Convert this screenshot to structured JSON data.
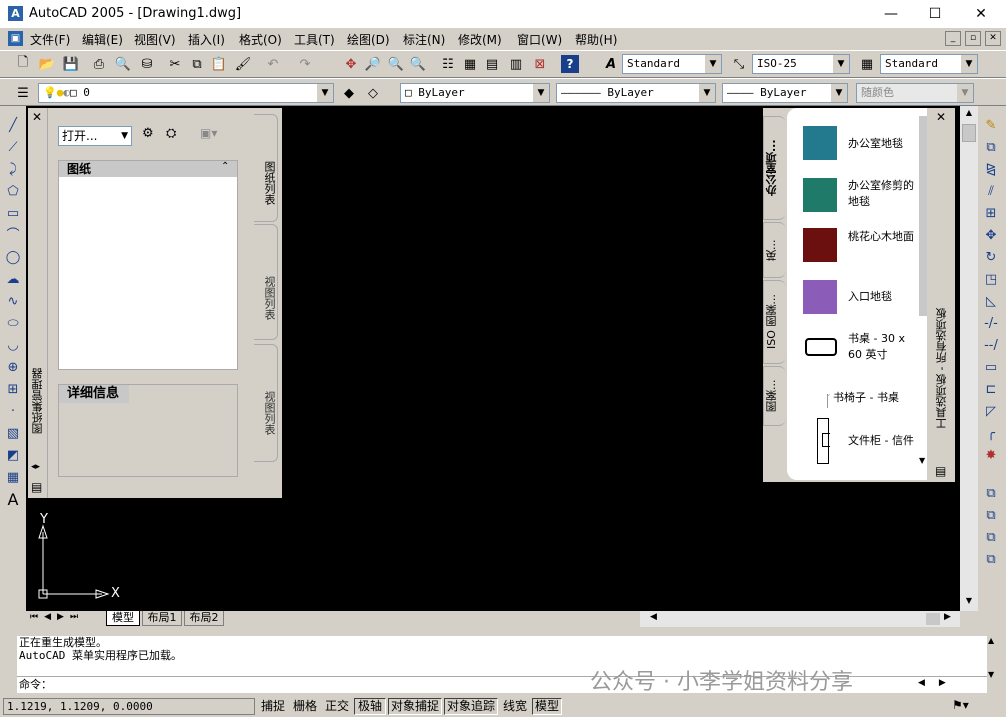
{
  "window": {
    "title": "AutoCAD 2005 - [Drawing1.dwg]",
    "app_icon": "A",
    "min": "—",
    "max": "☐",
    "close": "✕"
  },
  "menu": [
    "文件(F)",
    "编辑(E)",
    "视图(V)",
    "插入(I)",
    "格式(O)",
    "工具(T)",
    "绘图(D)",
    "标注(N)",
    "修改(M)",
    "窗口(W)",
    "帮助(H)"
  ],
  "toolbar": {
    "text_style": "Standard",
    "dim_style": "ISO-25",
    "table_style": "Standard",
    "layer": "0",
    "color": "ByLayer",
    "linetype": "ByLayer",
    "lineweight": "ByLayer",
    "plotstyle": "随颜色"
  },
  "sheet_manager": {
    "title": "图纸集管理器",
    "open_label": "打开...",
    "list_header": "图纸",
    "detail_header": "详细信息",
    "tabs": [
      "图纸列表",
      "视图列表",
      "视图列表"
    ]
  },
  "tool_palette": {
    "title": "工具选项板 - 所有选项板",
    "tabs": [
      "办公室项...",
      "英...",
      "ISO 图案...",
      "图案..."
    ],
    "items": [
      {
        "label": "办公室地毯",
        "color": "#23798e"
      },
      {
        "label": "办公室修剪的地毯",
        "color": "#1f7a6a"
      },
      {
        "label": "桃花心木地面",
        "color": "#6b0f0f"
      },
      {
        "label": "入口地毯",
        "color": "#8b5cb8"
      },
      {
        "label": "书桌 - 30 x 60 英寸",
        "icon": "desk-icon"
      },
      {
        "label": "书椅子 - 书桌",
        "icon": "chair-icon"
      },
      {
        "label": "文件柜 - 信件",
        "icon": "cabinet-icon"
      }
    ]
  },
  "canvas": {
    "ucs_x": "X",
    "ucs_y": "Y"
  },
  "layout_tabs": [
    "模型",
    "布局1",
    "布局2"
  ],
  "command": {
    "lines": [
      "正在重生成模型。",
      "AutoCAD 菜单实用程序已加载。"
    ],
    "prompt": "命令："
  },
  "status": {
    "coords": "1.1219, 1.1209, 0.0000",
    "buttons": [
      "捕捉",
      "栅格",
      "正交",
      "极轴",
      "对象捕捉",
      "对象追踪",
      "线宽",
      "模型"
    ]
  },
  "watermark": "公众号 · 小李学姐资料分享"
}
